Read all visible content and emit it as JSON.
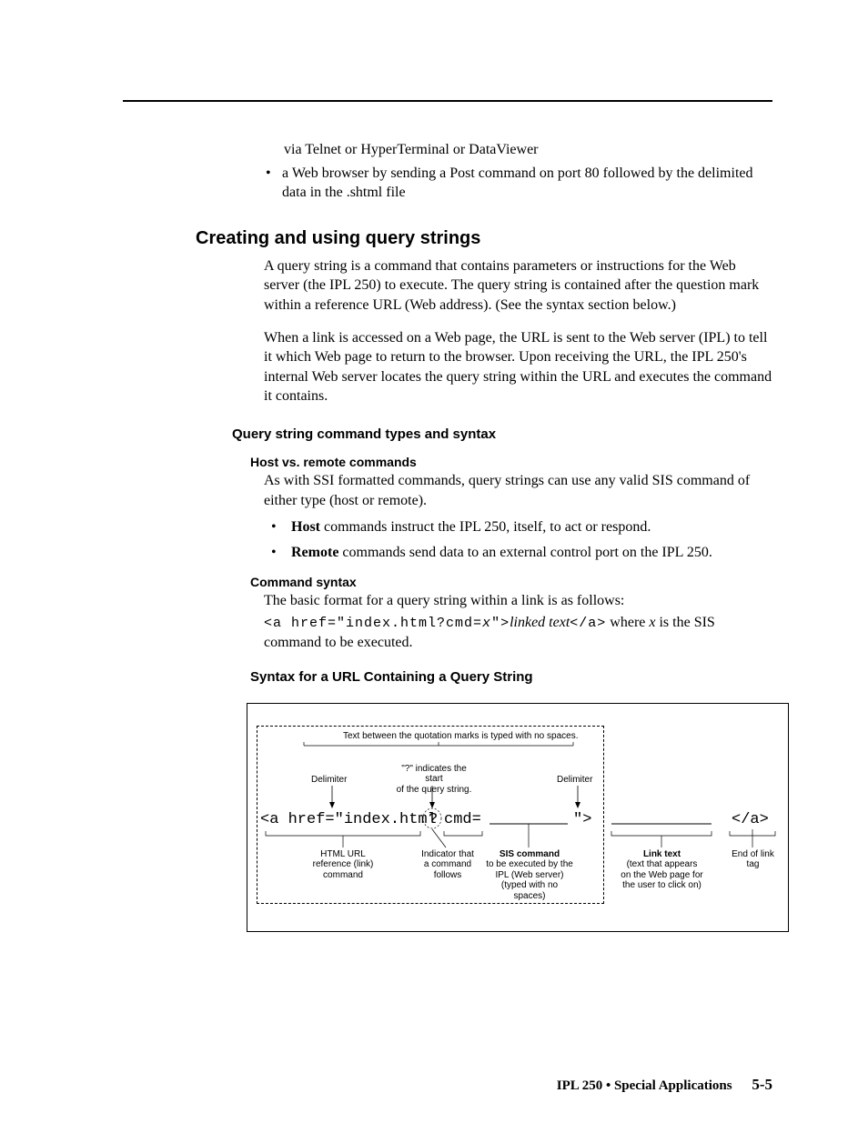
{
  "intro": {
    "line1": "via Telnet or HyperTerminal or DataViewer",
    "bullet": "a Web browser by sending a Post command on port 80 followed by the delimited data in the .shtml file"
  },
  "section": {
    "heading": "Creating and using query strings",
    "p1": "A query string is a command that contains parameters or instructions for the Web server (the IPL 250) to execute.  The query string is contained after the question mark within a reference URL (Web address).  (See the syntax section below.)",
    "p2": "When a link is accessed on a Web page, the URL is sent to the Web server (IPL) to tell it which Web page to return to the browser.  Upon receiving the URL, the IPL 250's internal Web server locates the query string within the URL and executes the command it contains."
  },
  "sub": {
    "heading": "Query string command types and syntax",
    "host_heading": "Host vs. remote commands",
    "host_p": "As with SSI formatted commands, query strings can use any valid SIS command of either type (host or remote).",
    "bullets": {
      "b1_strong": "Host",
      "b1_rest": " commands instruct the IPL 250, itself, to act or respond.",
      "b2_strong": "Remote",
      "b2_rest": " commands send data to an external control port on the IPL 250."
    },
    "cmd_heading": "Command syntax",
    "cmd_p1": "The basic format for a query string within a link is as follows:",
    "cmd_code_pre": "<a href=\"index.html?cmd=",
    "cmd_code_x": "x",
    "cmd_code_mid": "\">",
    "cmd_code_linked": "linked text",
    "cmd_code_end": "</a>",
    "cmd_where_pre": "    where ",
    "cmd_where_x": "x",
    "cmd_where_post": " is the SIS command to be executed."
  },
  "syntax_heading": "Syntax for a URL Containing a Query String",
  "diagram": {
    "note_top": "Text between the quotation marks is typed with no spaces.",
    "delimiter": "Delimiter",
    "q_note_a": "\"?\" indicates the start",
    "q_note_b": "of the query string.",
    "code_a": "<a href=\"index.html",
    "code_q": "?",
    "code_cmd": "cmd=",
    "code_close": "\">",
    "code_end": "</a>",
    "label_html1": "HTML URL",
    "label_html2": "reference (link)",
    "label_html3": "command",
    "label_ind1": "Indicator that",
    "label_ind2": "a command",
    "label_ind3": "follows",
    "label_sis1": "SIS command",
    "label_sis2": "to be executed by the",
    "label_sis3": "IPL (Web server)",
    "label_sis4": "(typed with no spaces)",
    "label_link1": "Link text",
    "label_link2": "(text that appears",
    "label_link3": "on the Web page for",
    "label_link4": "the user to click on)",
    "label_end1": "End of link",
    "label_end2": "tag"
  },
  "footer": {
    "text": "IPL 250 • Special Applications",
    "page": "5-5"
  }
}
